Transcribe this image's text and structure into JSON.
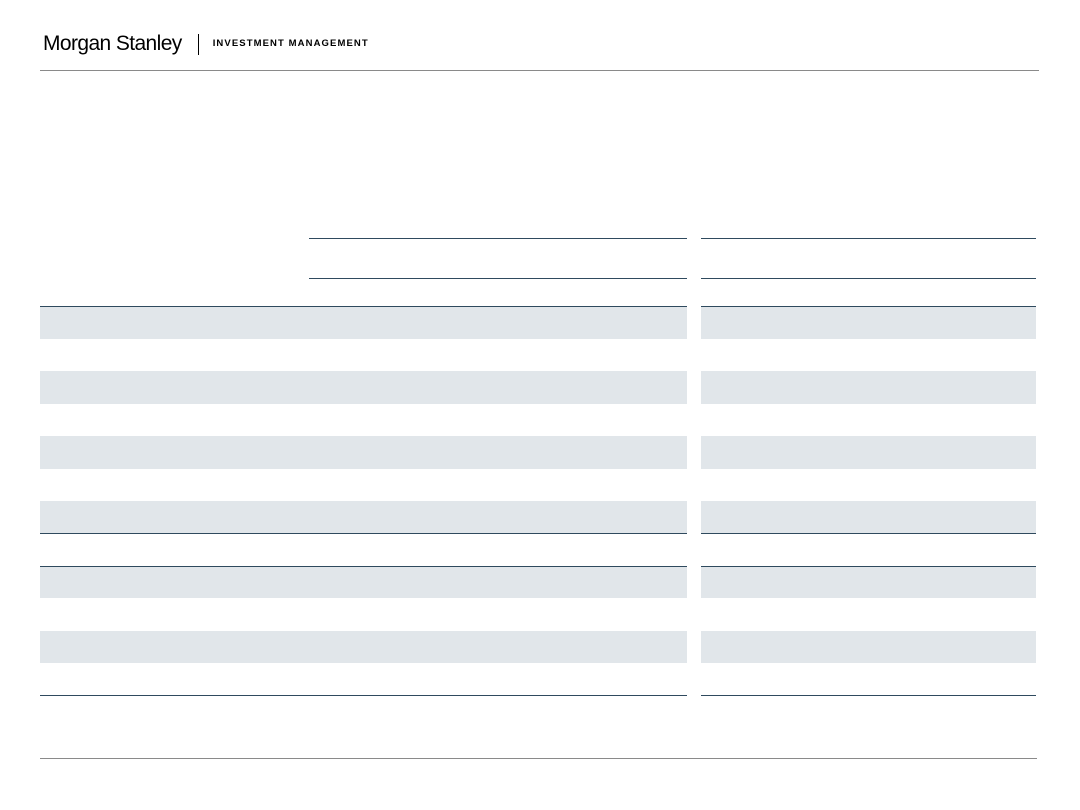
{
  "header": {
    "brand": "Morgan Stanley",
    "division": "INVESTMENT MANAGEMENT"
  },
  "colors": {
    "band_fill": "#e1e6ea",
    "rule_dark": "#2f4a5e",
    "rule_light": "#8a8a8a"
  }
}
